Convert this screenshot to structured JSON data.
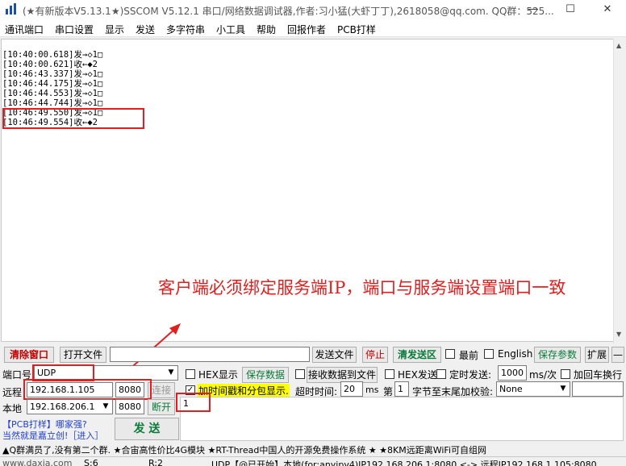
{
  "titlebar": {
    "title": "(★有新版本V5.13.1★)SSCOM V5.12.1 串口/网络数据调试器,作者:习小猛(大虾丁丁),2618058@qq.com. QQ群：525...",
    "min": "—",
    "max": "☐",
    "close": "✕"
  },
  "menu": [
    "通讯端口",
    "串口设置",
    "显示",
    "发送",
    "多字符串",
    "小工具",
    "帮助",
    "回报作者",
    "PCB打样"
  ],
  "log": [
    "[10:40:00.618]发→◇1□",
    "[10:40:00.621]收←◆2",
    "[10:46:43.337]发→◇1□",
    "[10:46:44.175]发→◇1□",
    "[10:46:44.553]发→◇1□",
    "[10:46:44.744]发→◇1□",
    "[10:46:49.550]发→◇1□",
    "[10:46:49.554]收←◆2"
  ],
  "annotation": "客户端必须绑定服务端IP，端口与服务端设置端口一致",
  "toolbar": {
    "clear": "清除窗口",
    "open_file": "打开文件",
    "send_file": "发送文件",
    "stop": "停止",
    "clear_send": "清发送区",
    "topmost": "最前",
    "english": "English",
    "save_params": "保存参数",
    "expand": "扩展",
    "collapse": "—"
  },
  "conn": {
    "port_label": "端口号",
    "port_value": "UDP",
    "remote_label": "远程",
    "remote_ip": "192.168.1.105",
    "remote_port": "8080",
    "connect": "连接",
    "local_label": "本地",
    "local_ip": "192.168.206.1",
    "local_port": "8080",
    "disconnect": "断开",
    "promo1": "【PCB打样】哪家强?",
    "promo2": "当然就是嘉立创!［进入］",
    "send": "发  送"
  },
  "options": {
    "hex_display": "HEX显示",
    "save_data": "保存数据",
    "recv_to_file": "接收数据到文件",
    "hex_send": "HEX发送",
    "timed_send": "定时发送:",
    "interval": "1000",
    "interval_unit": "ms/次",
    "add_crlf": "加回车换行",
    "timestamp": "加时间戳和分包显示.",
    "timeout_label": "超时时间:",
    "timeout_value": "20",
    "timeout_unit": "ms",
    "byte_index_label": "第",
    "byte_index": "1",
    "checksum_label": "字节至末尾加校验:",
    "checksum": "None",
    "send_text": "1"
  },
  "ticker": "▲Q群满员了,没有第二个群. ★合宙高性价比4G模块 ★RT-Thread中国人的开源免费操作系统 ★ ★8KM远距离WiFi可自组网",
  "status": [
    "www.daxia.com",
    "S:6",
    "R:2",
    "UDP【@已开始】本地(for:anyipv4)IP192.168.206.1:8080 <-> 远程IP192.168.1.105:8080"
  ],
  "colors": {
    "accent_red": "#e02020",
    "ticker_blue": "#1f3fcf",
    "button_green": "#0a7a3a",
    "highlight_yellow": "#ffff00"
  }
}
